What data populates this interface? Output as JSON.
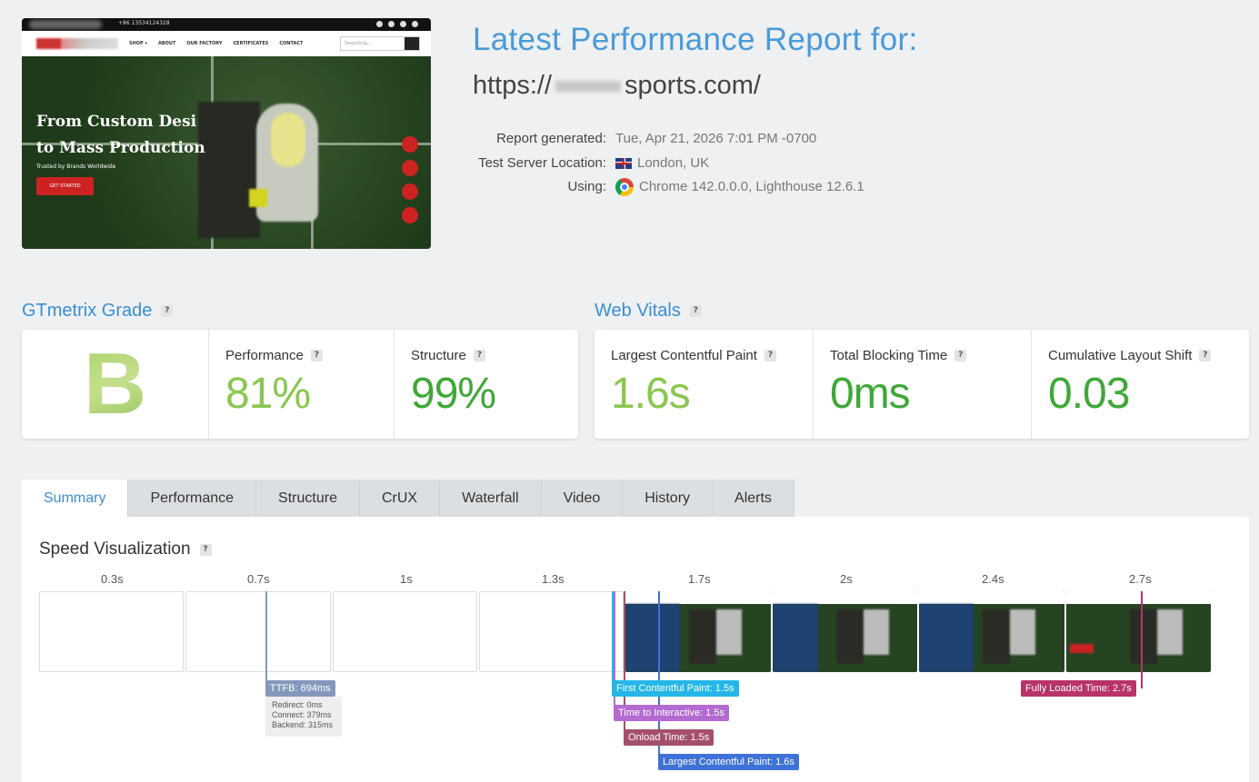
{
  "screenshot": {
    "phone": "+86 13534124328",
    "menu": [
      "SHOP ▾",
      "ABOUT",
      "OUR FACTORY",
      "CERTIFICATES",
      "CONTACT"
    ],
    "search_placeholder": "Searching...",
    "headline_1": "From Custom Desi",
    "headline_2": "to Mass Production",
    "tagline": "Trusted by Brands Worldwide",
    "cta": "GET STARTED"
  },
  "report": {
    "title": "Latest Performance Report for:",
    "url_prefix": "https://",
    "url_suffix": "sports.com/",
    "generated_label": "Report generated:",
    "generated_value": "Tue, Apr 21, 2026 7:01 PM -0700",
    "server_label": "Test Server Location:",
    "server_value": "London, UK",
    "using_label": "Using:",
    "using_value": "Chrome 142.0.0.0, Lighthouse 12.6.1"
  },
  "grade": {
    "heading": "GTmetrix Grade",
    "letter": "B",
    "performance_label": "Performance",
    "performance_value": "81%",
    "structure_label": "Structure",
    "structure_value": "99%"
  },
  "vitals": {
    "heading": "Web Vitals",
    "lcp_label": "Largest Contentful Paint",
    "lcp_value": "1.6s",
    "tbt_label": "Total Blocking Time",
    "tbt_value": "0ms",
    "cls_label": "Cumulative Layout Shift",
    "cls_value": "0.03"
  },
  "help": "?",
  "tabs": [
    "Summary",
    "Performance",
    "Structure",
    "CrUX",
    "Waterfall",
    "Video",
    "History",
    "Alerts"
  ],
  "speed": {
    "heading": "Speed Visualization",
    "ticks": [
      "0.3s",
      "0.7s",
      "1s",
      "1.3s",
      "1.7s",
      "2s",
      "2.4s",
      "2.7s"
    ],
    "ttfb": "TTFB: 694ms",
    "ttfb_redirect": "Redirect: 0ms",
    "ttfb_connect": "Connect: 379ms",
    "ttfb_backend": "Backend: 315ms",
    "fcp": "First Contentful Paint: 1.5s",
    "tti": "Time to Interactive: 1.5s",
    "onload": "Onload Time: 1.5s",
    "lcp": "Largest Contentful Paint: 1.6s",
    "fully_loaded": "Fully Loaded Time: 2.7s"
  },
  "colors": {
    "accent": "#3a8fd2",
    "good": "#53b04a",
    "fcp": "#25b6e8",
    "tti": "#b36ad1",
    "onload": "#a4506b",
    "lcp": "#3f72d8",
    "fully": "#b8336a",
    "ttfb": "#8497bd"
  }
}
